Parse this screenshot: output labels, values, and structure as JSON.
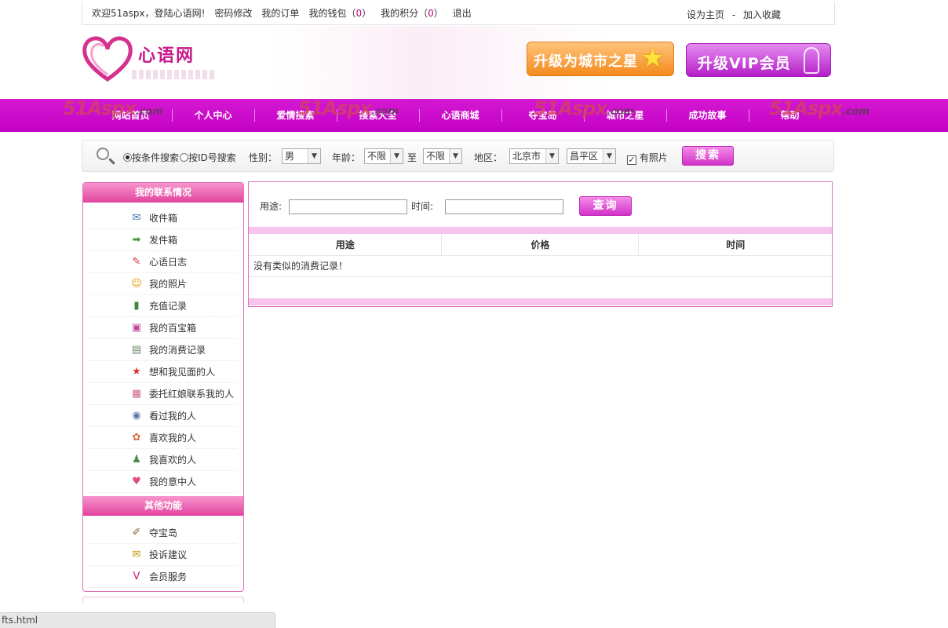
{
  "topbar": {
    "welcome": "欢迎51aspx，登陆心语网!",
    "change_password": "密码修改",
    "my_orders": "我的订单",
    "my_wallet": "我的钱包（",
    "wallet_count": "0",
    "wallet_close": "）",
    "my_points": "我的积分（",
    "points_count": "0",
    "points_close": "）",
    "logout": "退出",
    "set_home": "设为主页",
    "separator": "-",
    "add_favorite": "加入收藏"
  },
  "header": {
    "logo_text": "心语网",
    "upgrade_star": "升级为城市之星",
    "upgrade_vip": "升级VIP会员"
  },
  "nav": {
    "items": [
      "网站首页",
      "个人中心",
      "爱情搜索",
      "搜索大全",
      "心语商城",
      "夺宝岛",
      "城市之星",
      "成功故事",
      "帮助"
    ]
  },
  "watermark": {
    "main": "51Aspx",
    "suffix": ".com"
  },
  "search": {
    "mode_condition": "按条件搜索",
    "mode_id": "按ID号搜索",
    "gender_label": "性别：",
    "gender_value": "男",
    "age_label": "年龄：",
    "age_from": "不限",
    "age_to_label": "至",
    "age_to": "不限",
    "region_label": "地区：",
    "region_city": "北京市",
    "region_district": "昌平区",
    "has_photo_label": "有照片",
    "has_photo_checked": "✓",
    "button": "搜索"
  },
  "sidebar": {
    "contact_title": "我的联系情况",
    "contact_items": [
      {
        "label": "收件箱",
        "icon": "envelope-icon",
        "glyph": "✉",
        "color": "#3a6ea8"
      },
      {
        "label": "发件箱",
        "icon": "outbox-icon",
        "glyph": "➡",
        "color": "#4a9a3a"
      },
      {
        "label": "心语日志",
        "icon": "pencil-icon",
        "glyph": "✎",
        "color": "#d03a3a"
      },
      {
        "label": "我的照片",
        "icon": "smiley-icon",
        "glyph": "☺",
        "color": "#e0a000"
      },
      {
        "label": "充值记录",
        "icon": "book-icon",
        "glyph": "▮",
        "color": "#3a8a3a"
      },
      {
        "label": "我的百宝箱",
        "icon": "tv-icon",
        "glyph": "▣",
        "color": "#c04a9a"
      },
      {
        "label": "我的消费记录",
        "icon": "receipt-icon",
        "glyph": "▤",
        "color": "#6a8a6a"
      },
      {
        "label": "想和我见面的人",
        "icon": "star-icon",
        "glyph": "★",
        "color": "#e03030"
      },
      {
        "label": "委托红娘联系我的人",
        "icon": "card-icon",
        "glyph": "▦",
        "color": "#d06a8a"
      },
      {
        "label": "看过我的人",
        "icon": "eye-icon",
        "glyph": "◉",
        "color": "#5a7aaa"
      },
      {
        "label": "喜欢我的人",
        "icon": "flower-icon",
        "glyph": "✿",
        "color": "#e06a3a"
      },
      {
        "label": "我喜欢的人",
        "icon": "users-icon",
        "glyph": "♟",
        "color": "#4a8a4a"
      },
      {
        "label": "我的意中人",
        "icon": "heart-icon",
        "glyph": "♥",
        "color": "#e0507a"
      }
    ],
    "other_title": "其他功能",
    "other_items": [
      {
        "label": "夺宝岛",
        "icon": "note-icon",
        "glyph": "✐",
        "color": "#8a6a3a"
      },
      {
        "label": "投诉建议",
        "icon": "speech-bubble-icon",
        "glyph": "✉",
        "color": "#c09000"
      },
      {
        "label": "会员服务",
        "icon": "vip-icon",
        "glyph": "V",
        "color": "#c0207a"
      }
    ]
  },
  "main": {
    "purpose_label": "用途:",
    "purpose_value": "",
    "time_label": "时间:",
    "time_value": "",
    "query_button": "查询",
    "columns": [
      "用途",
      "价格",
      "时间"
    ],
    "empty_message": "没有类似的消费记录！"
  },
  "status_bar": {
    "url": "fts.html"
  },
  "colors": {
    "brand_magenta": "#c400c4",
    "accent_pink": "#e2439e",
    "count_color": "#c0007a"
  }
}
